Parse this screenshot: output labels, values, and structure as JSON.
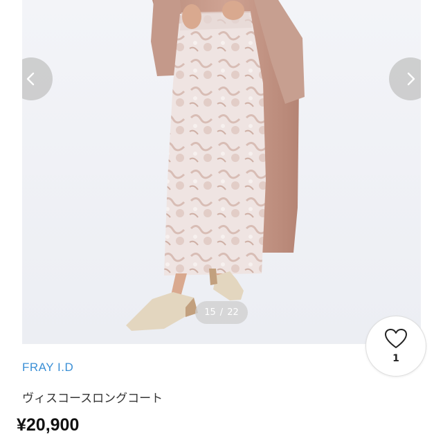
{
  "gallery": {
    "counter_current": "15",
    "counter_separator": "/",
    "counter_total": "22",
    "prev_icon": "chevron-left-icon",
    "next_icon": "chevron-right-icon"
  },
  "like": {
    "icon": "heart-outline-icon",
    "count": "1"
  },
  "product": {
    "brand": "FRAY I.D",
    "title": "ヴィスコースロングコート",
    "price": "¥20,900"
  },
  "colors": {
    "brand_link": "#3a8fd6",
    "coat": "#c99b8a",
    "skirt": "#ece0de"
  }
}
